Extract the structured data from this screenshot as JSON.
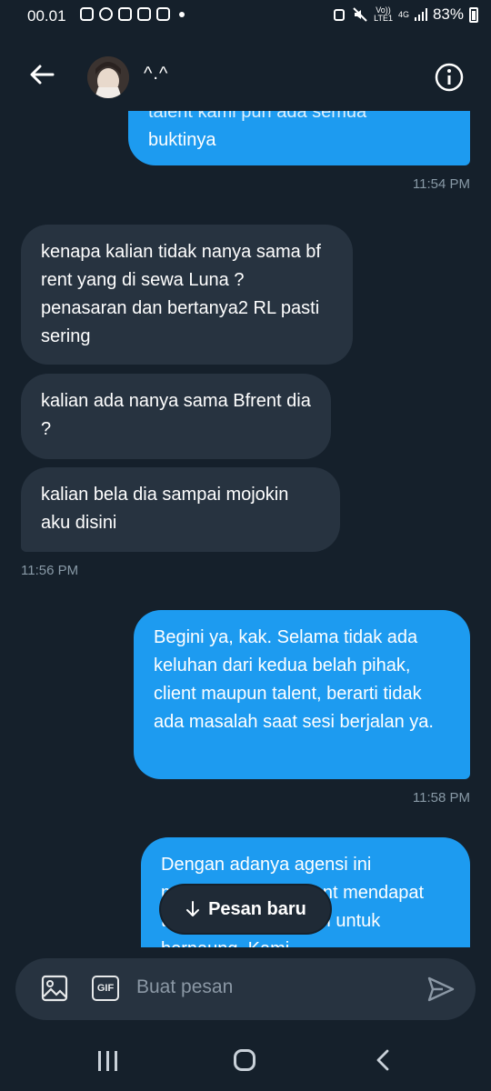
{
  "status_bar": {
    "time": "00.01",
    "network_top": "Vo))",
    "network_bottom": "LTE1",
    "data_type": "4G",
    "battery": "83%"
  },
  "header": {
    "contact_name": "^.^",
    "icons": {
      "back": "arrow-left-icon",
      "info": "info-circle-icon"
    }
  },
  "messages": [
    {
      "direction": "out",
      "text": "talent kami pun ada semua"
    },
    {
      "direction": "out",
      "text": "buktinya"
    },
    {
      "direction": "out_time",
      "text": "11:54 PM"
    },
    {
      "direction": "in",
      "text": "kenapa kalian tidak nanya sama bf rent yang di sewa Luna ? penasaran dan bertanya2 RL pasti sering"
    },
    {
      "direction": "in",
      "text": "kalian ada nanya sama Bfrent dia ?"
    },
    {
      "direction": "in",
      "text": "kalian bela dia sampai mojokin aku disini"
    },
    {
      "direction": "in_time",
      "text": "11:56 PM"
    },
    {
      "direction": "out",
      "text": "Begini ya, kak. Selama tidak ada keluhan dari kedua belah pihak, client maupun talent, berarti tidak ada masalah saat sesi berjalan ya."
    },
    {
      "direction": "out_time",
      "text": "11:58 PM"
    },
    {
      "direction": "out",
      "text": "Dengan adanya agensi ini membantu para talent mendapat tempat yang nyaman untuk bernaung. Kami"
    }
  ],
  "new_messages_pill": {
    "label": "Pesan baru",
    "icon": "arrow-down-icon"
  },
  "composer": {
    "placeholder": "Buat pesan",
    "gif_label": "GIF",
    "icons": {
      "image": "image-icon",
      "send": "send-icon"
    }
  },
  "colors": {
    "background": "#15202b",
    "outgoing": "#1d9bf0",
    "incoming": "#273340",
    "muted": "#8899a6"
  }
}
